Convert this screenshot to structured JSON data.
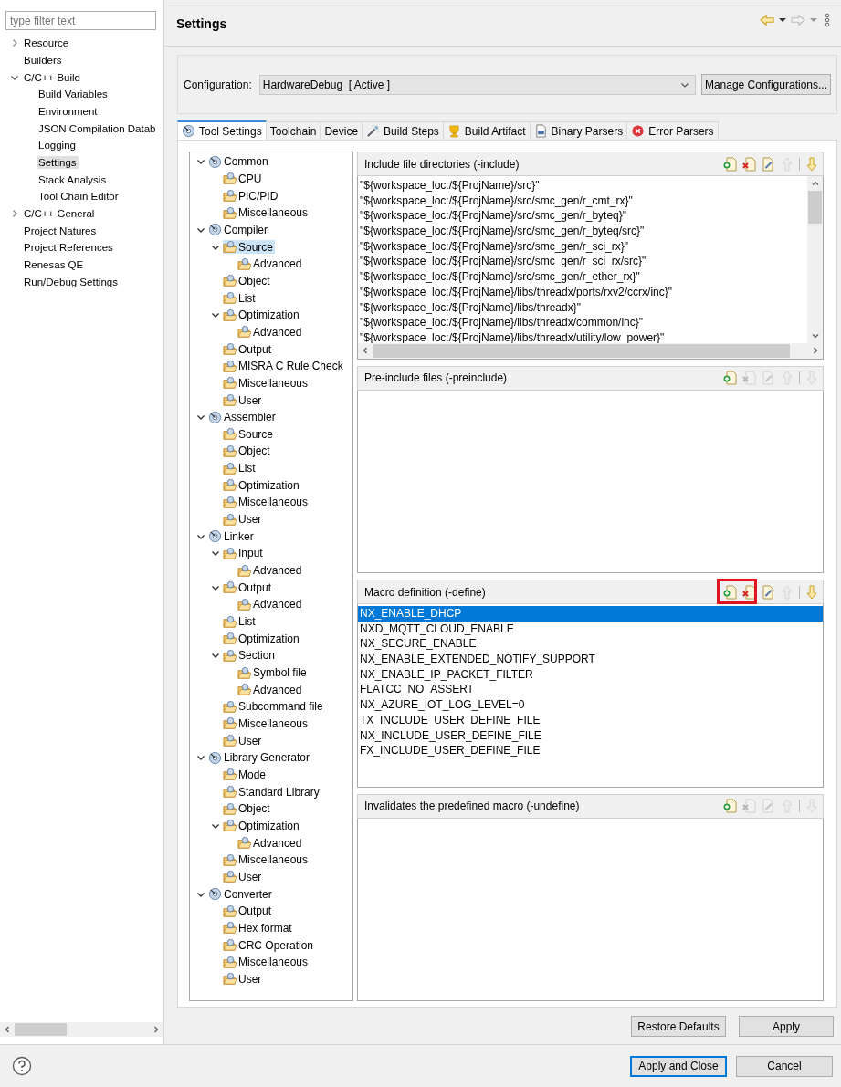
{
  "filter": {
    "placeholder": "type filter text"
  },
  "nav_tree": [
    {
      "label": "Resource",
      "expanded": false,
      "selected": false
    },
    {
      "label": "Builders",
      "selected": false
    },
    {
      "label": "C/C++ Build",
      "expanded": true,
      "selected": false,
      "children": [
        {
          "label": "Build Variables",
          "selected": false
        },
        {
          "label": "Environment",
          "selected": false
        },
        {
          "label": "JSON Compilation Datab",
          "selected": false
        },
        {
          "label": "Logging",
          "selected": false
        },
        {
          "label": "Settings",
          "selected": true
        },
        {
          "label": "Stack Analysis",
          "selected": false
        },
        {
          "label": "Tool Chain Editor",
          "selected": false
        }
      ]
    },
    {
      "label": "C/C++ General",
      "expanded": false,
      "selected": false
    },
    {
      "label": "Project Natures",
      "selected": false
    },
    {
      "label": "Project References",
      "selected": false
    },
    {
      "label": "Renesas QE",
      "selected": false
    },
    {
      "label": "Run/Debug Settings",
      "selected": false
    }
  ],
  "page_title": "Settings",
  "configuration": {
    "label": "Configuration:",
    "value": "HardwareDebug  [ Active ]",
    "manage_button": "Manage Configurations..."
  },
  "tabs": [
    {
      "label": "Tool Settings",
      "kind": "tool",
      "selected": true
    },
    {
      "label": "Toolchain",
      "kind": "plain",
      "selected": false
    },
    {
      "label": "Device",
      "kind": "plain",
      "selected": false
    },
    {
      "label": "Build Steps",
      "kind": "steps",
      "selected": false
    },
    {
      "label": "Build Artifact",
      "kind": "artifact",
      "selected": false
    },
    {
      "label": "Binary Parsers",
      "kind": "binary",
      "selected": false
    },
    {
      "label": "Error Parsers",
      "kind": "error",
      "selected": false
    }
  ],
  "tool_tree": [
    {
      "label": "Common",
      "kind": "tool",
      "expanded": true,
      "selected": false,
      "children": [
        {
          "label": "CPU",
          "kind": "category",
          "selected": false
        },
        {
          "label": "PIC/PID",
          "kind": "category",
          "selected": false
        },
        {
          "label": "Miscellaneous",
          "kind": "category",
          "selected": false
        }
      ]
    },
    {
      "label": "Compiler",
      "kind": "tool",
      "expanded": true,
      "selected": false,
      "children": [
        {
          "label": "Source",
          "kind": "category",
          "expanded": true,
          "selected": true,
          "children": [
            {
              "label": "Advanced",
              "kind": "category",
              "selected": false
            }
          ]
        },
        {
          "label": "Object",
          "kind": "category",
          "selected": false
        },
        {
          "label": "List",
          "kind": "category",
          "selected": false
        },
        {
          "label": "Optimization",
          "kind": "category",
          "expanded": true,
          "selected": false,
          "children": [
            {
              "label": "Advanced",
              "kind": "category",
              "selected": false
            }
          ]
        },
        {
          "label": "Output",
          "kind": "category",
          "selected": false
        },
        {
          "label": "MISRA C Rule Check",
          "kind": "category",
          "selected": false
        },
        {
          "label": "Miscellaneous",
          "kind": "category",
          "selected": false
        },
        {
          "label": "User",
          "kind": "category",
          "selected": false
        }
      ]
    },
    {
      "label": "Assembler",
      "kind": "tool",
      "expanded": true,
      "selected": false,
      "children": [
        {
          "label": "Source",
          "kind": "category",
          "selected": false
        },
        {
          "label": "Object",
          "kind": "category",
          "selected": false
        },
        {
          "label": "List",
          "kind": "category",
          "selected": false
        },
        {
          "label": "Optimization",
          "kind": "category",
          "selected": false
        },
        {
          "label": "Miscellaneous",
          "kind": "category",
          "selected": false
        },
        {
          "label": "User",
          "kind": "category",
          "selected": false
        }
      ]
    },
    {
      "label": "Linker",
      "kind": "tool",
      "expanded": true,
      "selected": false,
      "children": [
        {
          "label": "Input",
          "kind": "category",
          "expanded": true,
          "selected": false,
          "children": [
            {
              "label": "Advanced",
              "kind": "category",
              "selected": false
            }
          ]
        },
        {
          "label": "Output",
          "kind": "category",
          "expanded": true,
          "selected": false,
          "children": [
            {
              "label": "Advanced",
              "kind": "category",
              "selected": false
            }
          ]
        },
        {
          "label": "List",
          "kind": "category",
          "selected": false
        },
        {
          "label": "Optimization",
          "kind": "category",
          "selected": false
        },
        {
          "label": "Section",
          "kind": "category",
          "expanded": true,
          "selected": false,
          "children": [
            {
              "label": "Symbol file",
              "kind": "category",
              "selected": false
            },
            {
              "label": "Advanced",
              "kind": "category",
              "selected": false
            }
          ]
        },
        {
          "label": "Subcommand file",
          "kind": "category",
          "selected": false
        },
        {
          "label": "Miscellaneous",
          "kind": "category",
          "selected": false
        },
        {
          "label": "User",
          "kind": "category",
          "selected": false
        }
      ]
    },
    {
      "label": "Library Generator",
      "kind": "tool",
      "expanded": true,
      "selected": false,
      "children": [
        {
          "label": "Mode",
          "kind": "category",
          "selected": false
        },
        {
          "label": "Standard Library",
          "kind": "category",
          "selected": false
        },
        {
          "label": "Object",
          "kind": "category",
          "selected": false
        },
        {
          "label": "Optimization",
          "kind": "category",
          "expanded": true,
          "selected": false,
          "children": [
            {
              "label": "Advanced",
              "kind": "category",
              "selected": false
            }
          ]
        },
        {
          "label": "Miscellaneous",
          "kind": "category",
          "selected": false
        },
        {
          "label": "User",
          "kind": "category",
          "selected": false
        }
      ]
    },
    {
      "label": "Converter",
      "kind": "tool",
      "expanded": true,
      "selected": false,
      "children": [
        {
          "label": "Output",
          "kind": "category",
          "selected": false
        },
        {
          "label": "Hex format",
          "kind": "category",
          "selected": false
        },
        {
          "label": "CRC Operation",
          "kind": "category",
          "selected": false
        },
        {
          "label": "Miscellaneous",
          "kind": "category",
          "selected": false
        },
        {
          "label": "User",
          "kind": "category",
          "selected": false
        }
      ]
    }
  ],
  "sections": [
    {
      "title": "Include file directories (-include)",
      "scrollbars": true,
      "highlight_box": false,
      "tools": [
        {
          "kind": "add",
          "enabled": true
        },
        {
          "kind": "delete",
          "enabled": true
        },
        {
          "kind": "edit",
          "enabled": true
        },
        {
          "kind": "up",
          "enabled": false
        },
        {
          "kind": "down",
          "enabled": true
        }
      ],
      "items": [
        {
          "text": "\"${workspace_loc:/${ProjName}/src}\"",
          "selected": false
        },
        {
          "text": "\"${workspace_loc:/${ProjName}/src/smc_gen/r_cmt_rx}\"",
          "selected": false
        },
        {
          "text": "\"${workspace_loc:/${ProjName}/src/smc_gen/r_byteq}\"",
          "selected": false
        },
        {
          "text": "\"${workspace_loc:/${ProjName}/src/smc_gen/r_byteq/src}\"",
          "selected": false
        },
        {
          "text": "\"${workspace_loc:/${ProjName}/src/smc_gen/r_sci_rx}\"",
          "selected": false
        },
        {
          "text": "\"${workspace_loc:/${ProjName}/src/smc_gen/r_sci_rx/src}\"",
          "selected": false
        },
        {
          "text": "\"${workspace_loc:/${ProjName}/src/smc_gen/r_ether_rx}\"",
          "selected": false
        },
        {
          "text": "\"${workspace_loc:/${ProjName}/libs/threadx/ports/rxv2/ccrx/inc}\"",
          "selected": false
        },
        {
          "text": "\"${workspace_loc:/${ProjName}/libs/threadx}\"",
          "selected": false
        },
        {
          "text": "\"${workspace_loc:/${ProjName}/libs/threadx/common/inc}\"",
          "selected": false
        },
        {
          "text": "\"${workspace_loc:/${ProjName}/libs/threadx/utility/low_power}\"",
          "selected": false
        }
      ]
    },
    {
      "title": "Pre-include files (-preinclude)",
      "scrollbars": false,
      "highlight_box": false,
      "tools": [
        {
          "kind": "add",
          "enabled": true
        },
        {
          "kind": "delete",
          "enabled": false
        },
        {
          "kind": "edit",
          "enabled": false
        },
        {
          "kind": "up",
          "enabled": false
        },
        {
          "kind": "down",
          "enabled": false
        }
      ]
    },
    {
      "title": "Macro definition (-define)",
      "scrollbars": false,
      "highlight_box": true,
      "tools": [
        {
          "kind": "add",
          "enabled": true
        },
        {
          "kind": "delete",
          "enabled": true
        },
        {
          "kind": "edit",
          "enabled": true
        },
        {
          "kind": "up",
          "enabled": false
        },
        {
          "kind": "down",
          "enabled": true
        }
      ],
      "items": [
        {
          "text": "NX_ENABLE_DHCP",
          "selected": true
        },
        {
          "text": "NXD_MQTT_CLOUD_ENABLE",
          "selected": false
        },
        {
          "text": "NX_SECURE_ENABLE",
          "selected": false
        },
        {
          "text": "NX_ENABLE_EXTENDED_NOTIFY_SUPPORT",
          "selected": false
        },
        {
          "text": "NX_ENABLE_IP_PACKET_FILTER",
          "selected": false
        },
        {
          "text": "FLATCC_NO_ASSERT",
          "selected": false
        },
        {
          "text": "NX_AZURE_IOT_LOG_LEVEL=0",
          "selected": false
        },
        {
          "text": "TX_INCLUDE_USER_DEFINE_FILE",
          "selected": false
        },
        {
          "text": "NX_INCLUDE_USER_DEFINE_FILE",
          "selected": false
        },
        {
          "text": "FX_INCLUDE_USER_DEFINE_FILE",
          "selected": false
        }
      ]
    },
    {
      "title": "Invalidates the predefined macro (-undefine)",
      "scrollbars": false,
      "highlight_box": false,
      "tools": [
        {
          "kind": "add",
          "enabled": true
        },
        {
          "kind": "delete",
          "enabled": false
        },
        {
          "kind": "edit",
          "enabled": false
        },
        {
          "kind": "up",
          "enabled": false
        },
        {
          "kind": "down",
          "enabled": false
        }
      ]
    }
  ],
  "page_buttons": [
    {
      "label": "Restore Defaults",
      "default": false
    },
    {
      "label": "Apply",
      "default": false
    }
  ],
  "dialog_buttons": [
    {
      "label": "Apply and Close",
      "default": true
    },
    {
      "label": "Cancel",
      "default": false
    }
  ]
}
